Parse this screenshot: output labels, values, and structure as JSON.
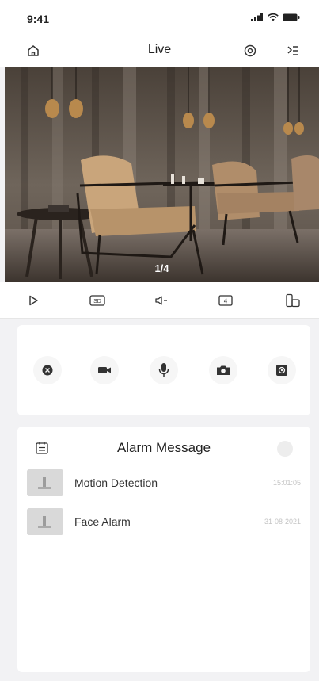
{
  "status_bar": {
    "time": "9:41"
  },
  "nav": {
    "title": "Live"
  },
  "video": {
    "page_indicator": "1/4"
  },
  "toolbar": {
    "quality_label": "SD",
    "split_label": "4"
  },
  "controls": {
    "caption": ""
  },
  "alarm": {
    "title": "Alarm Message",
    "items": [
      {
        "label": "Motion Detection",
        "time": "15:01:05"
      },
      {
        "label": "Face Alarm",
        "time": "31-08-2021"
      }
    ]
  },
  "colors": {
    "background": "#f2f2f4",
    "card": "#ffffff",
    "icon": "#333333",
    "muted_text": "#c4c4c4"
  },
  "icons": {
    "nav_left": "home-icon",
    "nav_right": [
      "settings-icon",
      "menu-icon"
    ],
    "toolbar": [
      "play-icon",
      "sd-quality-icon",
      "speaker-icon",
      "split-screen-icon",
      "screen-rotate-icon"
    ],
    "controls": [
      "ptz-icon",
      "record-icon",
      "microphone-icon",
      "snapshot-icon",
      "focus-icon"
    ],
    "alarm": [
      "calendar-icon",
      "more-icon"
    ]
  }
}
